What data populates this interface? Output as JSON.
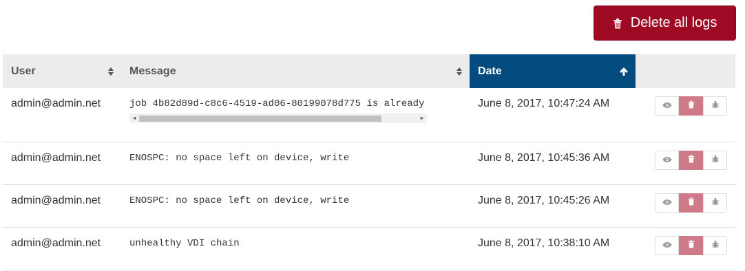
{
  "toolbar": {
    "delete_all_label": "Delete all logs",
    "delete_all_icon": "trash-icon"
  },
  "table": {
    "columns": [
      {
        "label": "User",
        "sort": "none"
      },
      {
        "label": "Message",
        "sort": "none"
      },
      {
        "label": "Date",
        "sort": "ascending"
      },
      {
        "label": "",
        "sort": "none"
      }
    ],
    "rows": [
      {
        "user": "admin@admin.net",
        "message": "job 4b82d89d-c8c6-4519-ad06-80199078d775 is already",
        "date": "June 8, 2017, 10:47:24 AM"
      },
      {
        "user": "admin@admin.net",
        "message": "ENOSPC: no space left on device, write",
        "date": "June 8, 2017, 10:45:36 AM"
      },
      {
        "user": "admin@admin.net",
        "message": "ENOSPC: no space left on device, write",
        "date": "June 8, 2017, 10:45:26 AM"
      },
      {
        "user": "admin@admin.net",
        "message": "unhealthy VDI chain",
        "date": "June 8, 2017, 10:38:10 AM"
      }
    ],
    "row_actions": [
      "eye-icon",
      "trash-icon",
      "bug-icon"
    ]
  },
  "colors": {
    "danger": "#9e0a24",
    "header_active": "#044b7f",
    "header_bg": "#ebeced",
    "row_delete_button": "#cf7a88"
  }
}
